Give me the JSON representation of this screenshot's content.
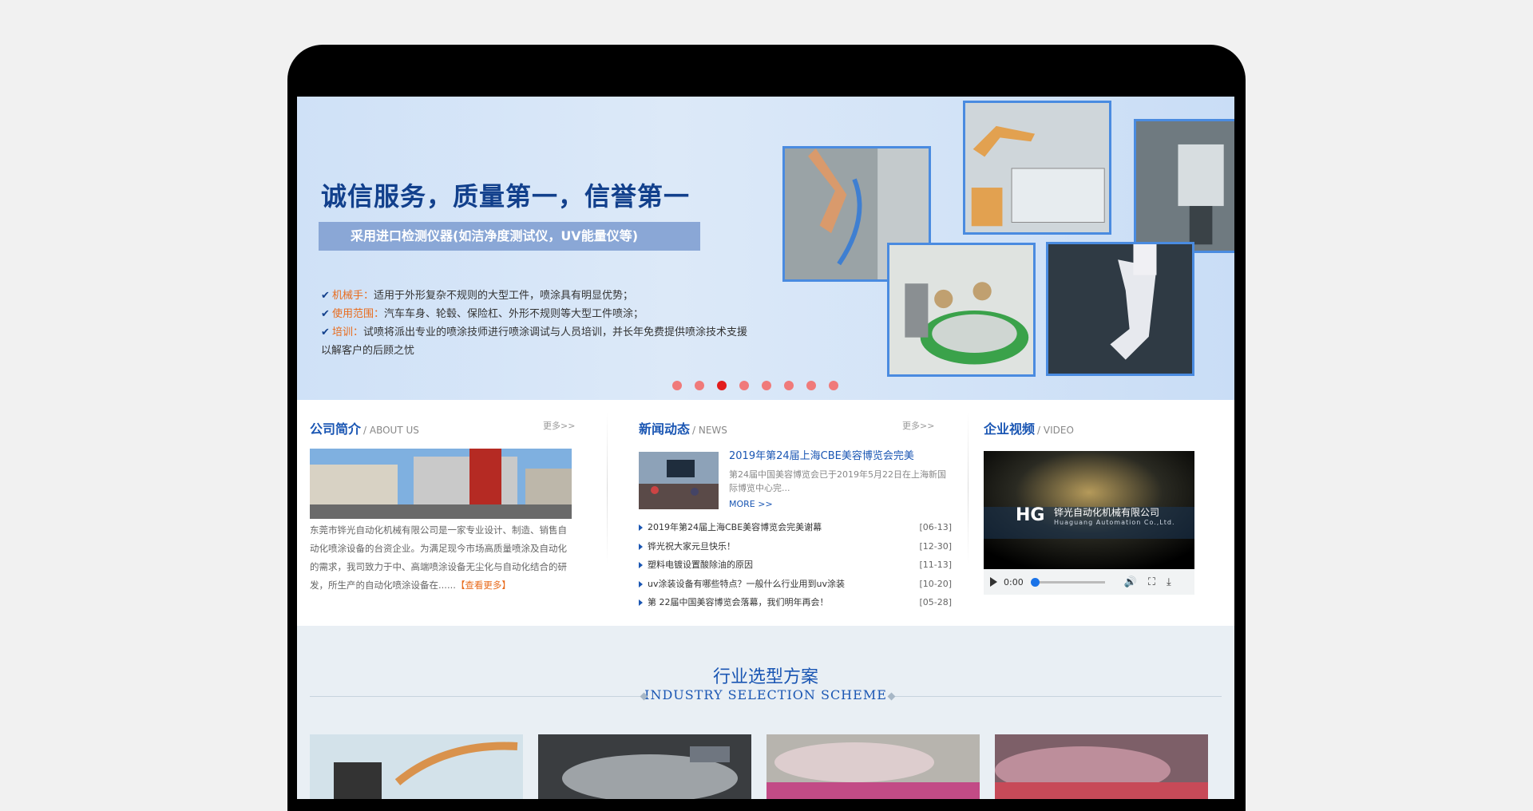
{
  "banner": {
    "title": "诚信服务，质量第一，信誉第一",
    "strip": "采用进口检测仪器(如洁净度测试仪，UV能量仪等)",
    "features": [
      {
        "key": "机械手：",
        "text": "适用于外形复杂不规则的大型工件，喷涂具有明显优势；"
      },
      {
        "key": "使用范围：",
        "text": "汽车车身、轮毂、保险杠、外形不规则等大型工件喷涂；"
      },
      {
        "key": "培训：",
        "text": "试喷将派出专业的喷涂技师进行喷涂调试与人员培训，并长年免费提供喷涂技术支援"
      }
    ],
    "feature_cont": "以解客户的后顾之忧",
    "check": "✔",
    "slide_count": 8,
    "active_slide": 3
  },
  "about": {
    "title": "公司简介",
    "en": "/ ABOUT US",
    "more": "更多>>",
    "text": "东莞市铧光自动化机械有限公司是一家专业设计、制造、销售自动化喷涂设备的台资企业。为满足现今市场高质量喷涂及自动化的需求，我司致力于中、高端喷涂设备无尘化与自动化结合的研发，所生产的自动化喷涂设备在......",
    "link": "【查看更多】"
  },
  "news": {
    "title": "新闻动态",
    "en": "/ NEWS",
    "more": "更多>>",
    "top_title": "2019年第24届上海CBE美容博览会完美",
    "top_desc": "第24届中国美容博览会已于2019年5月22日在上海新国际博览中心完...",
    "top_more": "MORE >>",
    "items": [
      {
        "t": "2019年第24届上海CBE美容博览会完美谢幕",
        "d": "[06-13]"
      },
      {
        "t": "铧光祝大家元旦快乐！",
        "d": "[12-30]"
      },
      {
        "t": "塑料电镀设置酸除油的原因",
        "d": "[11-13]"
      },
      {
        "t": "uv涂装设备有哪些特点？一般什么行业用到uv涂装",
        "d": "[10-20]"
      },
      {
        "t": "第 22届中国美容博览会落幕，我们明年再会！",
        "d": "[05-28]"
      }
    ]
  },
  "video": {
    "title": "企业视频",
    "en": "/ VIDEO",
    "company": "铧光自动化机械有限公司",
    "company_en": "Huaguang Automation Co.,Ltd.",
    "time": "0:00",
    "icons": [
      "play-icon",
      "volume-icon",
      "fullscreen-icon",
      "download-icon"
    ]
  },
  "industry": {
    "title": "行业选型方案",
    "en": "INDUSTRY SELECTION SCHEME"
  },
  "colors": {
    "brand": "#1a56b3",
    "accent": "#e86b1c",
    "dot_active": "#e21d1d"
  }
}
